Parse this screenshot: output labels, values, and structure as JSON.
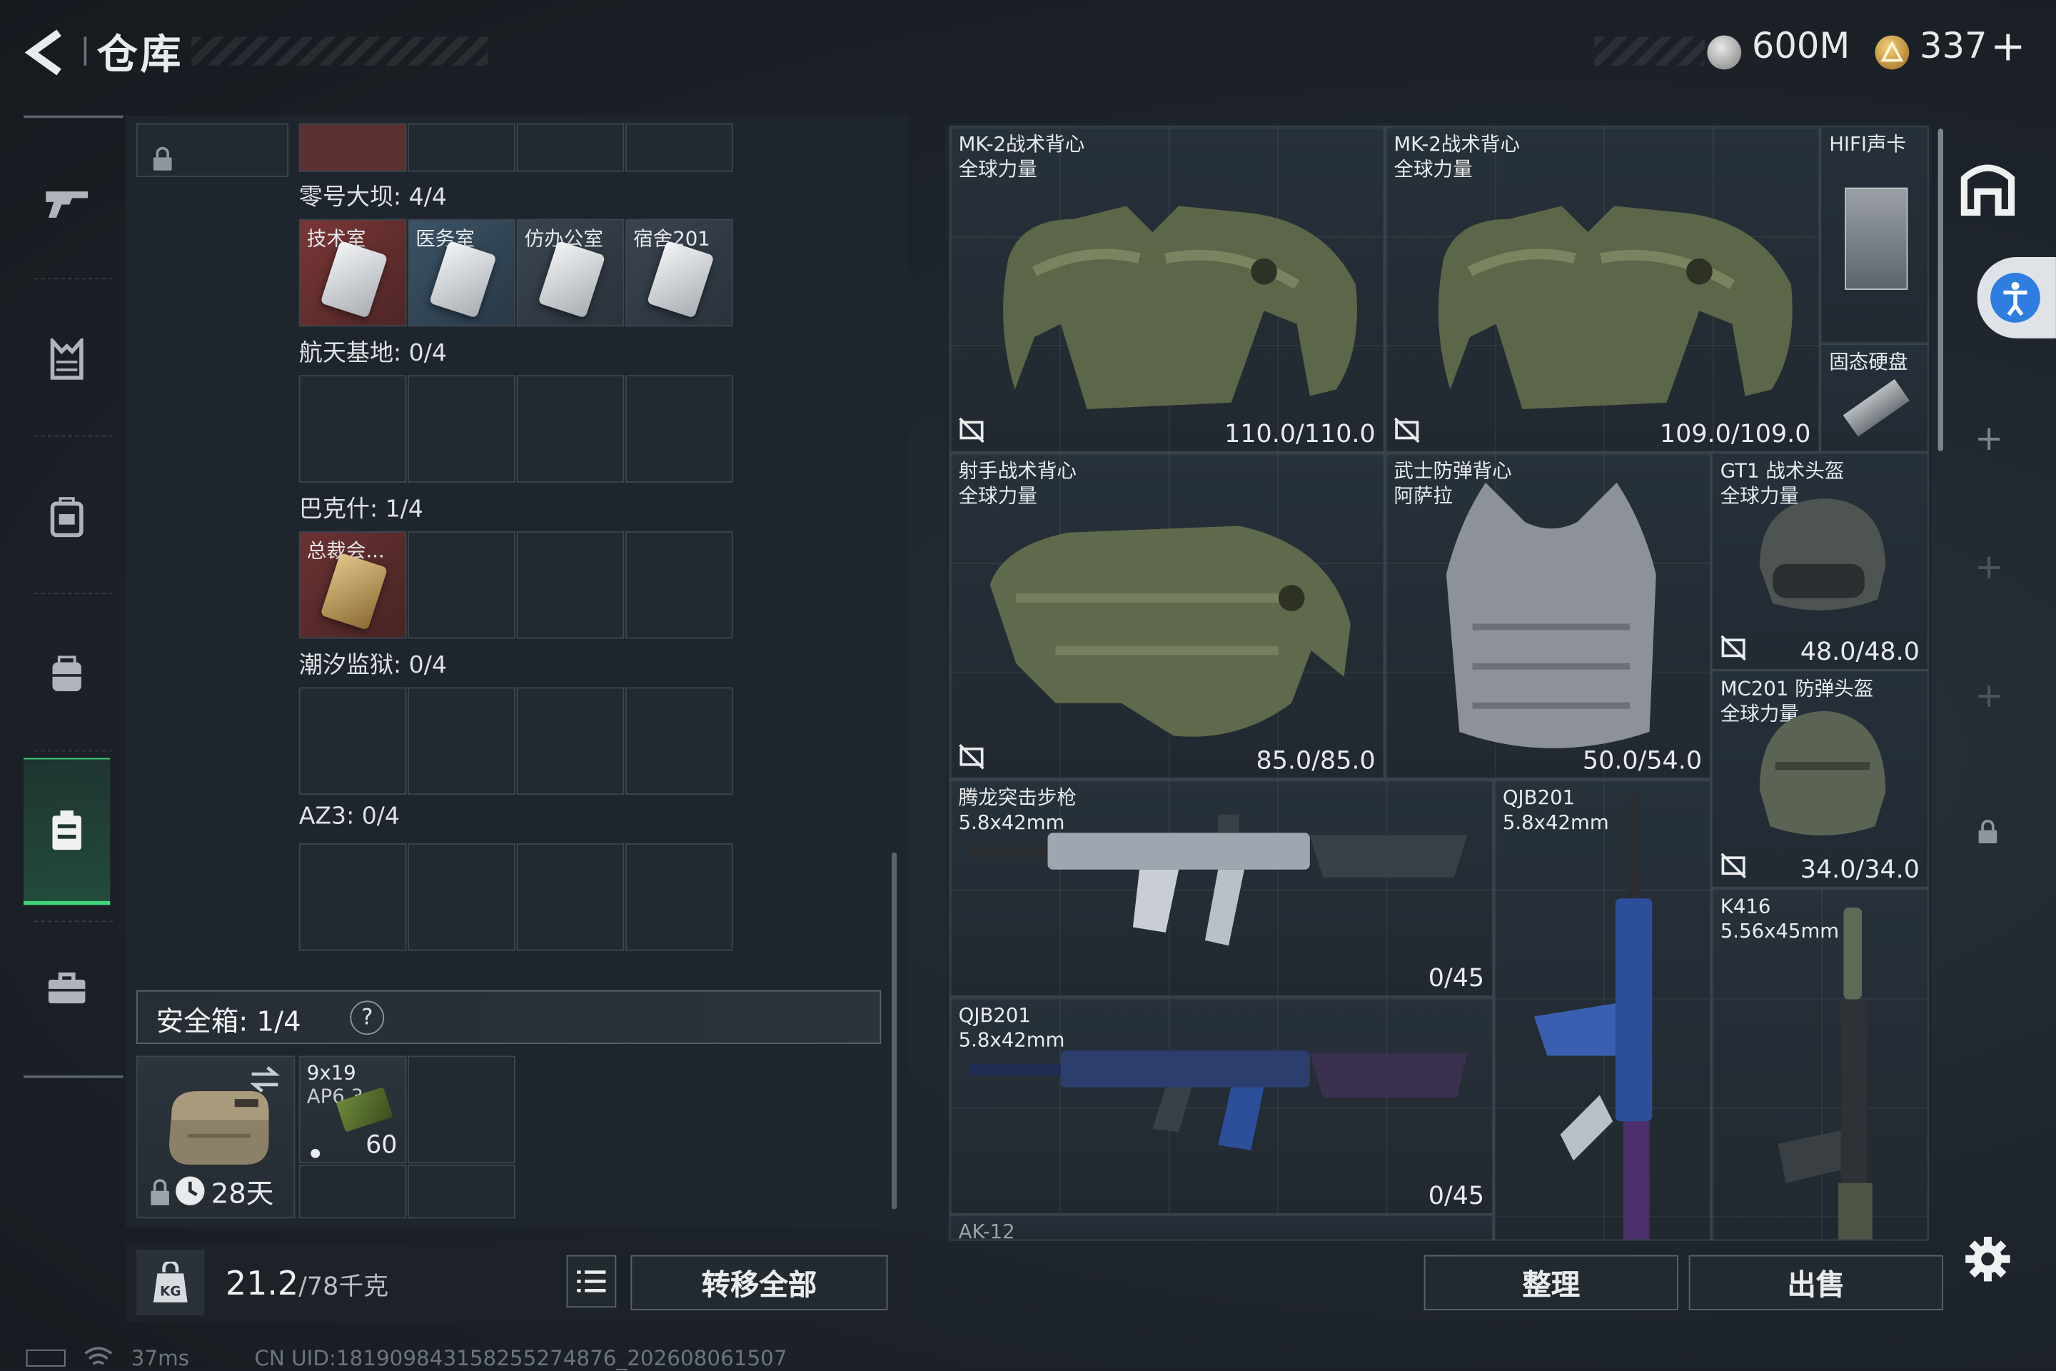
{
  "header": {
    "title": "仓库",
    "currency": [
      {
        "icon": "coin-icon",
        "value": "600M",
        "color": "#c9c9c9"
      },
      {
        "icon": "gold-triangle-icon",
        "value": "337",
        "color": "#d8a53a"
      }
    ],
    "add_label": "+"
  },
  "sidebar": {
    "items": [
      {
        "name": "weapons",
        "icon": "rifle-icon"
      },
      {
        "name": "armor",
        "icon": "vest-icon"
      },
      {
        "name": "backpack",
        "icon": "backpack-icon"
      },
      {
        "name": "chest-rig",
        "icon": "chest-rig-icon"
      },
      {
        "name": "safe-box",
        "icon": "safe-box-icon",
        "active": true
      },
      {
        "name": "briefcase",
        "icon": "briefcase-icon"
      }
    ],
    "active_color": "#3fd67a"
  },
  "keychain": {
    "groups": [
      {
        "title": "零号大坝: 4/4",
        "slots": [
          "技术室",
          "医务室",
          "仿办公室",
          "宿舍201"
        ]
      },
      {
        "title": "航天基地: 0/4",
        "slots": [
          "",
          "",
          "",
          ""
        ]
      },
      {
        "title": "巴克什: 1/4",
        "slots": [
          "总裁会...",
          "",
          "",
          ""
        ]
      },
      {
        "title": "潮汐监狱: 0/4",
        "slots": [
          "",
          "",
          "",
          ""
        ]
      },
      {
        "title": "AZ3: 0/4",
        "slots": [
          "",
          "",
          "",
          ""
        ]
      }
    ]
  },
  "safe_box": {
    "title": "安全箱: 1/4",
    "help": "?",
    "timer": "28天",
    "ammo": {
      "name": "9x19",
      "subname": "AP6.3",
      "count": "60"
    }
  },
  "weight": {
    "current": "21.2",
    "max": "/78千克"
  },
  "buttons": {
    "transfer_all": "转移全部",
    "organize": "整理",
    "sell": "出售"
  },
  "stash": {
    "items": [
      {
        "name": "MK-2战术背心\n全球力量",
        "durability": "110.0/110.0"
      },
      {
        "name": "MK-2战术背心\n全球力量",
        "durability": "109.0/109.0"
      },
      {
        "name": "HIFI声卡",
        "durability": ""
      },
      {
        "name": "固态硬盘",
        "durability": ""
      },
      {
        "name": "射手战术背心\n全球力量",
        "durability": "85.0/85.0"
      },
      {
        "name": "武士防弹背心\n阿萨拉",
        "durability": "50.0/54.0"
      },
      {
        "name": "GT1 战术头盔\n全球力量",
        "durability": "48.0/48.0"
      },
      {
        "name": "MC201 防弹头盔\n全球力量",
        "durability": "34.0/34.0"
      },
      {
        "name": "腾龙突击步枪\n5.8x42mm",
        "ammo": "0/45"
      },
      {
        "name": "QJB201\n5.8x42mm",
        "ammo": ""
      },
      {
        "name": "K416\n5.56x45mm",
        "ammo": ""
      },
      {
        "name": "QJB201\n5.8x42mm",
        "ammo": "0/45"
      },
      {
        "name": "AK-12",
        "ammo": ""
      }
    ]
  },
  "status_bar": {
    "ping": "37ms",
    "uid": "CN UID:18190984315825527487​6_202608061507"
  }
}
